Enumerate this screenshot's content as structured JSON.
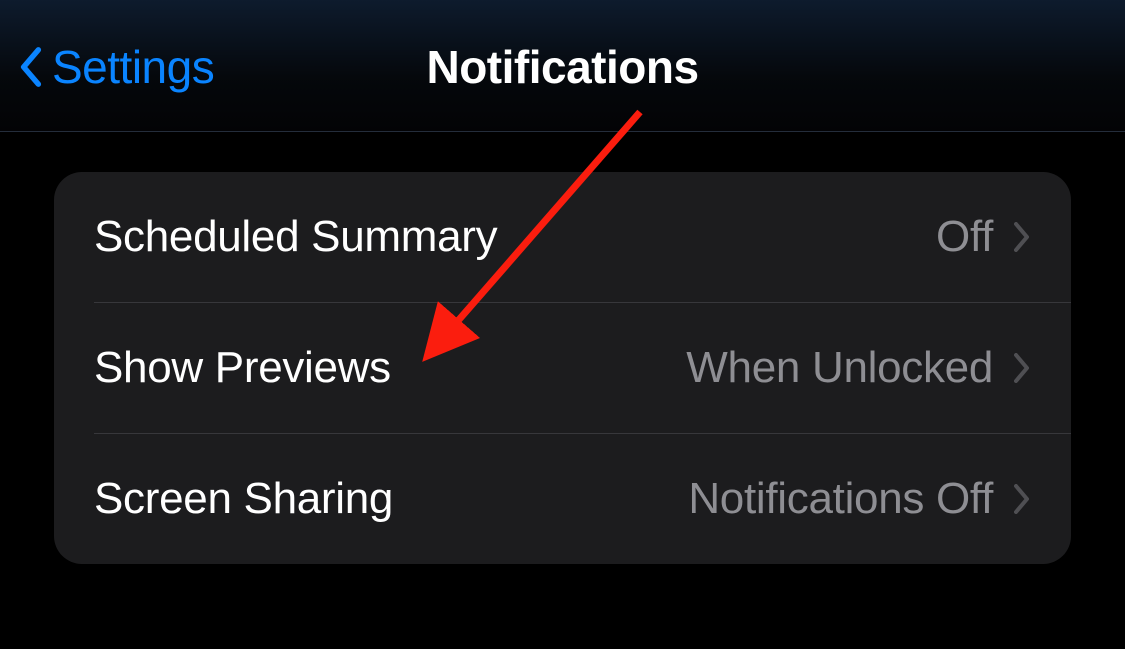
{
  "header": {
    "back_label": "Settings",
    "title": "Notifications"
  },
  "settings_group": {
    "rows": [
      {
        "label": "Scheduled Summary",
        "value": "Off"
      },
      {
        "label": "Show Previews",
        "value": "When Unlocked"
      },
      {
        "label": "Screen Sharing",
        "value": "Notifications Off"
      }
    ]
  },
  "colors": {
    "accent": "#0a84ff",
    "secondary": "#8e8e93",
    "background": "#000000",
    "group_bg": "#1c1c1e",
    "annotation": "#fb1d0e"
  }
}
